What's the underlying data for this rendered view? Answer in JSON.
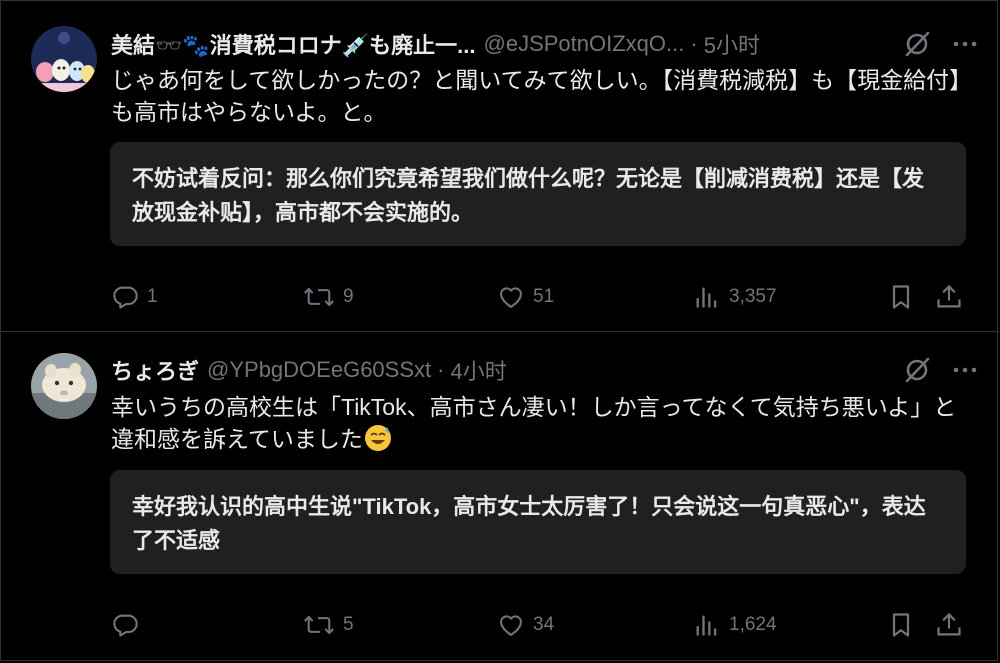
{
  "tweets": [
    {
      "name": "美結🕶️🐾消費税コロナ💉も廃止一...",
      "handle": "@eJSPotnOIZxqO...",
      "time": "5小时",
      "text": "じゃあ何をして欲しかったの？と聞いてみて欲しい。【消費税減税】も【現金給付】も高市はやらないよ。と。",
      "translation": "不妨试着反问：那么你们究竟希望我们做什么呢？无论是【削减消费税】还是【发放现金补贴】，高市都不会实施的。",
      "replies": "1",
      "retweets": "9",
      "likes": "51",
      "views": "3,357"
    },
    {
      "name": "ちょろぎ",
      "handle": "@YPbgDOEeG60SSxt",
      "time": "4小时",
      "text": "幸いうちの高校生は「TikTok、高市さん凄い！しか言ってなくて気持ち悪いよ」と違和感を訴えていました",
      "translation": "幸好我认识的高中生说\"TikTok，高市女士太厉害了！只会说这一句真恶心\"，表达了不适感",
      "replies": "",
      "retweets": "5",
      "likes": "34",
      "views": "1,624"
    }
  ],
  "icons": {
    "reply": "reply-icon",
    "retweet": "retweet-icon",
    "like": "heart-icon",
    "views": "views-icon",
    "bookmark": "bookmark-icon",
    "share": "share-icon",
    "grok": "grok-icon",
    "more": "more-icon"
  },
  "colors": {
    "background": "#000000",
    "text": "#e7e9ea",
    "muted": "#71767b",
    "translation_box": "#202020",
    "divider": "#2f3336"
  }
}
